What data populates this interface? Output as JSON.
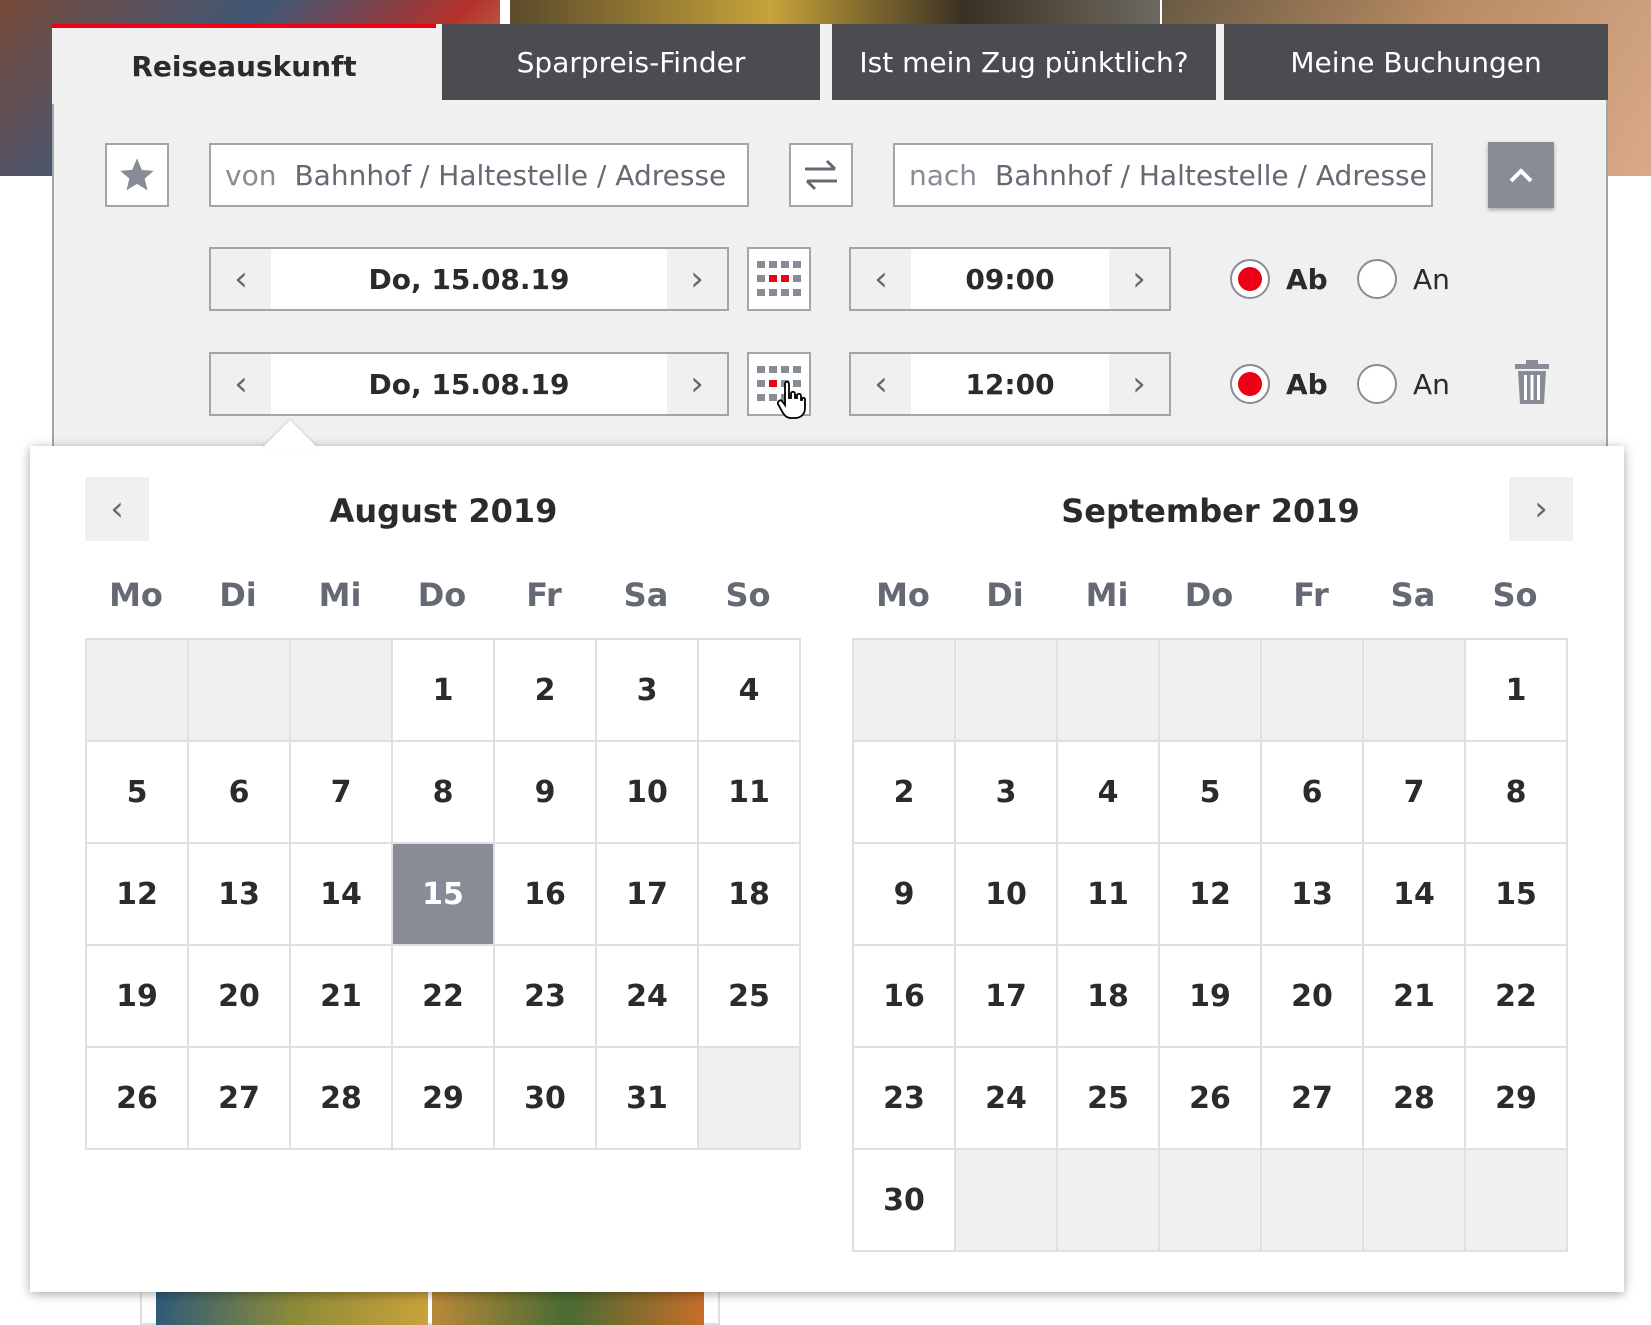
{
  "tabs": [
    {
      "label": "Reiseauskunft",
      "active": true
    },
    {
      "label": "Sparpreis-Finder",
      "active": false
    },
    {
      "label": "Ist mein Zug pünktlich?",
      "active": false
    },
    {
      "label": "Meine Buchungen",
      "active": false
    }
  ],
  "search": {
    "from_prefix": "von",
    "from_placeholder": "Bahnhof / Haltestelle / Adresse",
    "to_prefix": "nach",
    "to_placeholder": "Bahnhof / Haltestelle / Adresse"
  },
  "outbound": {
    "date": "Do, 15.08.19",
    "time": "09:00",
    "mode_selected": "Ab",
    "options": [
      "Ab",
      "An"
    ]
  },
  "return": {
    "date": "Do, 15.08.19",
    "time": "12:00",
    "mode_selected": "Ab",
    "options": [
      "Ab",
      "An"
    ]
  },
  "calendar": {
    "weekdays": [
      "Mo",
      "Di",
      "Mi",
      "Do",
      "Fr",
      "Sa",
      "So"
    ],
    "months": [
      {
        "title": "August 2019",
        "first_weekday_index": 3,
        "days": 31,
        "selected_day": 15
      },
      {
        "title": "September 2019",
        "first_weekday_index": 6,
        "days": 30,
        "selected_day": null
      }
    ]
  },
  "colors": {
    "accent_red": "#ec0016",
    "tab_dark": "#4b4c4f",
    "selected_day": "#878c96",
    "panel_bg": "#f0f0f0"
  },
  "icons": {
    "favorite": "star-icon",
    "swap": "swap-arrows-icon",
    "collapse": "chevron-up-icon",
    "calendar": "calendar-grid-icon",
    "delete": "trash-icon",
    "prev": "chevron-left-icon",
    "next": "chevron-right-icon"
  }
}
